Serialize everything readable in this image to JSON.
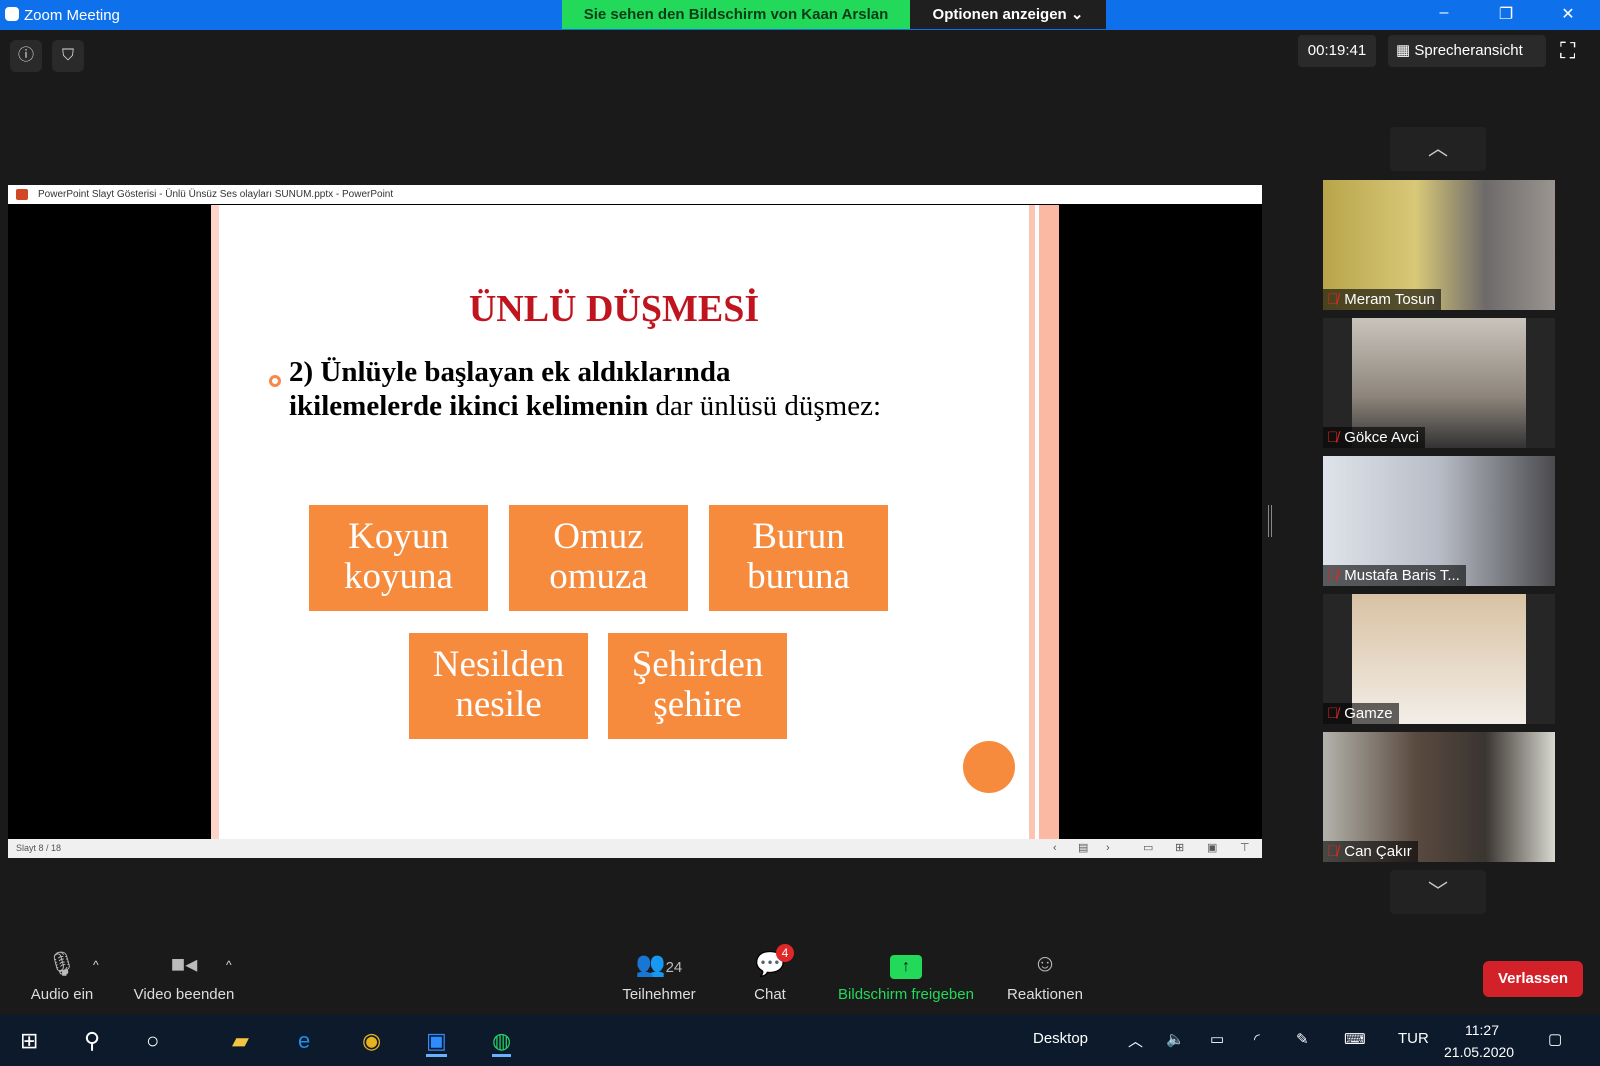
{
  "window": {
    "title": "Zoom Meeting",
    "share_banner": "Sie sehen den Bildschirm von Kaan Arslan",
    "options": "Optionen anzeigen"
  },
  "header": {
    "timer": "00:19:41",
    "view": "Sprecheransicht"
  },
  "ppt": {
    "title": "PowerPoint Slayt Gösterisi  -  Ünlü Ünsüz Ses olayları SUNUM.pptx - PowerPoint",
    "status": "Slayt 8 / 18"
  },
  "slide": {
    "title": "ÜNLÜ DÜŞMESİ",
    "text_bold": "2) Ünlüyle başlayan ek aldıklarında ikilemelerde ikinci kelimenin",
    "text_normal": " dar ünlüsü düşmez:",
    "boxes": [
      {
        "l1": "Koyun",
        "l2": "koyuna"
      },
      {
        "l1": "Omuz",
        "l2": "omuza"
      },
      {
        "l1": "Burun",
        "l2": "buruna"
      },
      {
        "l1": "Nesilden",
        "l2": "nesile"
      },
      {
        "l1": "Şehirden",
        "l2": "şehire"
      }
    ],
    "accent": "#f68b3e",
    "title_color": "#c0151f"
  },
  "participants": [
    {
      "name": "Meram Tosun"
    },
    {
      "name": "Gökce Avci"
    },
    {
      "name": "Mustafa Baris T..."
    },
    {
      "name": "Gamze"
    },
    {
      "name": "Can Çakır"
    }
  ],
  "toolbar": {
    "audio": "Audio ein",
    "video": "Video beenden",
    "participants": "Teilnehmer",
    "participant_count": "24",
    "chat": "Chat",
    "chat_badge": "4",
    "share": "Bildschirm freigeben",
    "reactions": "Reaktionen",
    "leave": "Verlassen"
  },
  "taskbar": {
    "desktop": "Desktop",
    "lang": "TUR",
    "time": "11:27",
    "date": "21.05.2020"
  }
}
